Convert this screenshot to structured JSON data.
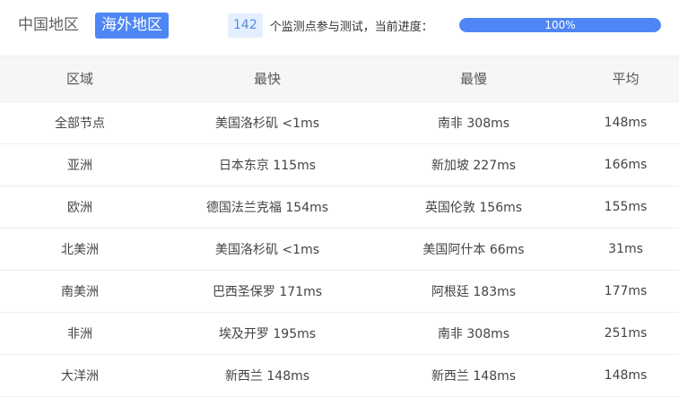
{
  "tabs": [
    {
      "label": "中国地区",
      "active": false
    },
    {
      "label": "海外地区",
      "active": true
    }
  ],
  "progress": {
    "count": "142",
    "label": "个监测点参与测试，当前进度：",
    "percent": 100,
    "percent_text": "100%"
  },
  "table": {
    "headers": [
      "区域",
      "最快",
      "最慢",
      "平均"
    ],
    "rows": [
      [
        "全部节点",
        "美国洛杉矶 <1ms",
        "南非 308ms",
        "148ms"
      ],
      [
        "亚洲",
        "日本东京 115ms",
        "新加坡 227ms",
        "166ms"
      ],
      [
        "欧洲",
        "德国法兰克福 154ms",
        "英国伦敦 156ms",
        "155ms"
      ],
      [
        "北美洲",
        "美国洛杉矶 <1ms",
        "美国阿什本 66ms",
        "31ms"
      ],
      [
        "南美洲",
        "巴西圣保罗 171ms",
        "阿根廷 183ms",
        "177ms"
      ],
      [
        "非洲",
        "埃及开罗 195ms",
        "南非 308ms",
        "251ms"
      ],
      [
        "大洋洲",
        "新西兰 148ms",
        "新西兰 148ms",
        "148ms"
      ]
    ]
  },
  "colors": {
    "accent": "#4e86f5",
    "badge_bg": "#e3efff",
    "header_bg": "#f6f6f6"
  }
}
